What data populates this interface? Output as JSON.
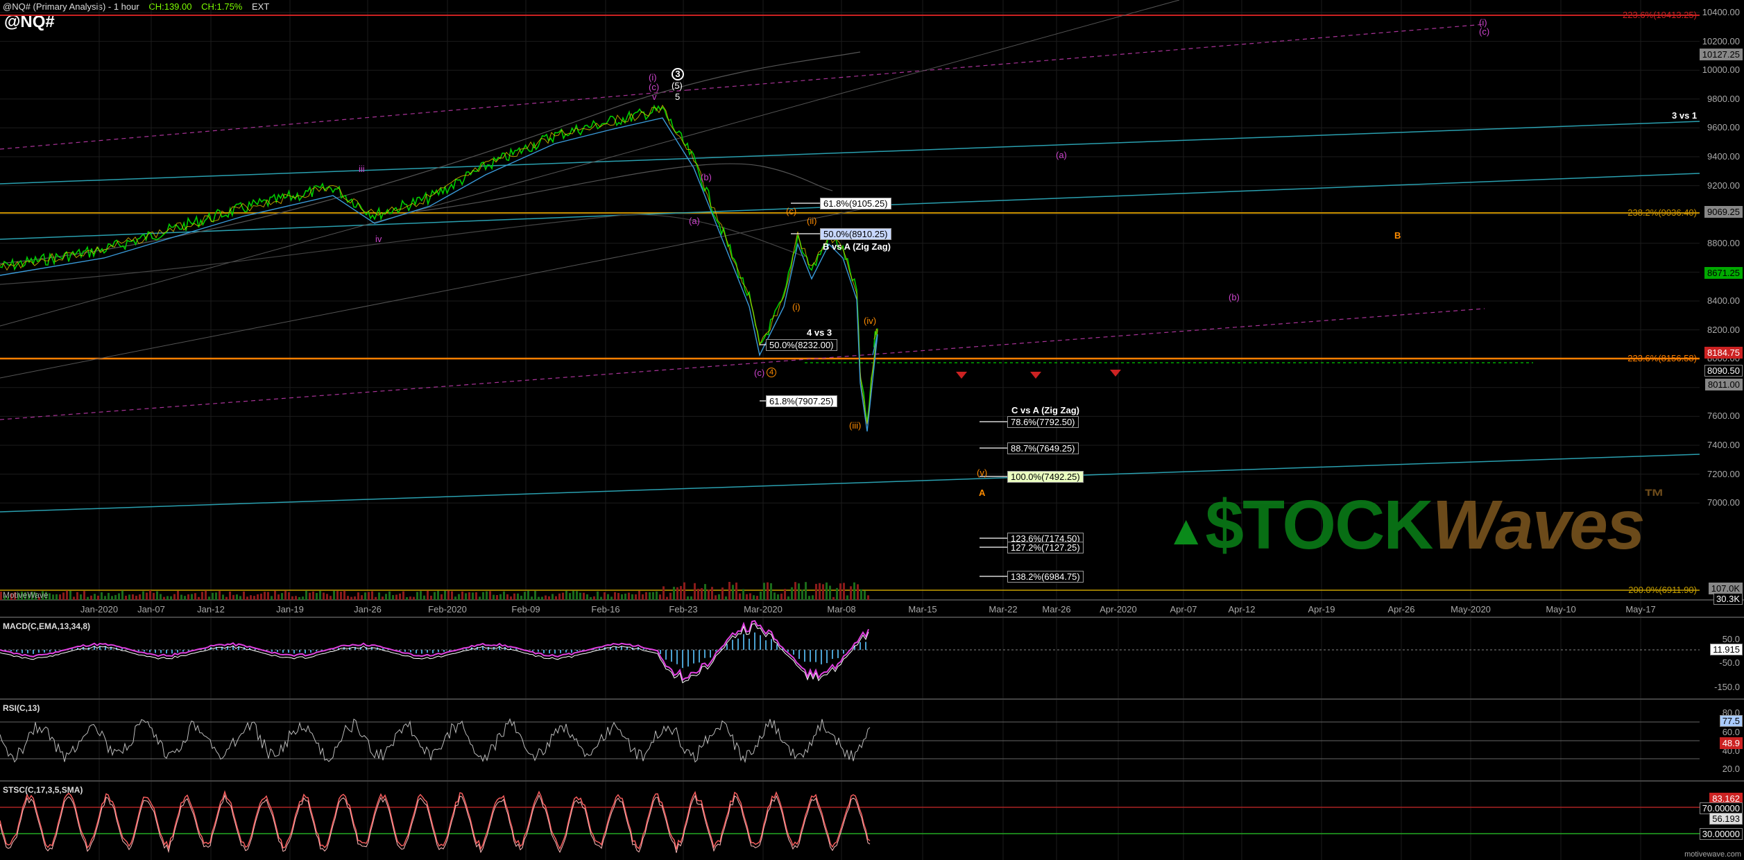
{
  "header": {
    "title": "@NQ# (Primary Analysis) - 1 hour",
    "change_points": "CH:139.00",
    "change_pct": "CH:1.75%",
    "session": "EXT",
    "symbol": "@NQ#"
  },
  "price_pane": {
    "study_label": "MotiveWave",
    "y_ticks": [
      "10400.00",
      "10200.00",
      "10000.00",
      "9800.00",
      "9600.00",
      "9400.00",
      "9200.00",
      "9000.00",
      "8800.00",
      "8600.00",
      "8400.00",
      "8200.00",
      "8000.00",
      "7800.00",
      "7600.00",
      "7400.00",
      "7200.00",
      "7000.00"
    ],
    "x_ticks": [
      "Jan-2020",
      "Jan-07",
      "Jan-12",
      "Jan-19",
      "Jan-26",
      "Feb-2020",
      "Feb-09",
      "Feb-16",
      "Feb-23",
      "Mar-2020",
      "Mar-08",
      "Mar-15",
      "Mar-22",
      "Mar-26",
      "Apr-2020",
      "Apr-07",
      "Apr-12",
      "Apr-19",
      "Apr-26",
      "May-2020",
      "May-10",
      "May-17"
    ],
    "price_tags": [
      {
        "text": "10127.25",
        "color": "#888888"
      },
      {
        "text": "9069.25",
        "color": "#888888"
      },
      {
        "text": "8671.25",
        "color": "#00aa00"
      },
      {
        "text": "8184.75",
        "color": "#cc2222"
      },
      {
        "text": "8090.50",
        "color": "#888888"
      },
      {
        "text": "8011.00",
        "color": "#888888"
      },
      {
        "text": "107.0K",
        "color": "#888888"
      },
      {
        "text": "30.3K",
        "color": "#888888"
      }
    ],
    "level_labels": [
      {
        "text": "223.6%(10413.25)",
        "color": "#cc2222"
      },
      {
        "text": "238.2%(9036.40)",
        "color": "#c89000"
      },
      {
        "text": "223.6%(8156.58)",
        "color": "#ff7f00"
      },
      {
        "text": "200.0%(6911.90)",
        "color": "#c8a000"
      }
    ],
    "fib_boxes": [
      {
        "text": "61.8%(9105.25)"
      },
      {
        "text": "50.0%(8910.25)"
      },
      {
        "text": "50.0%(8232.00)"
      },
      {
        "text": "61.8%(7907.25)"
      },
      {
        "text": "78.6%(7792.50)"
      },
      {
        "text": "88.7%(7649.25)"
      },
      {
        "text": "100.0%(7492.25)"
      },
      {
        "text": "123.6%(7174.50)"
      },
      {
        "text": "127.2%(7127.25)"
      },
      {
        "text": "138.2%(6984.75)"
      }
    ],
    "notes": [
      "3 vs 1",
      "B vs A (Zig Zag)",
      "4 vs 3",
      "C vs A (Zig Zag)"
    ],
    "wave_labels": [
      "3",
      "(5)",
      "5",
      "(i)",
      "(c)",
      "v",
      "iii",
      "iv",
      "(b)",
      "(a)",
      "(c)",
      "(ii)",
      "(i)",
      "(iv)",
      "(iii)",
      "(c)",
      "(a)",
      "(b)",
      "(v)",
      "A",
      "B",
      "(i)",
      "(c)",
      "4"
    ]
  },
  "logo": {
    "prefix": "$TOCK",
    "suffix": "Waves",
    "tm": "™"
  },
  "macd": {
    "title": "MACD(C,EMA,13,34,8)",
    "ticks": [
      "50.0",
      "-50.0",
      "-150.0"
    ],
    "value": "11.915"
  },
  "rsi": {
    "title": "RSI(C,13)",
    "ticks": [
      "80.0",
      "60.0",
      "40.0",
      "20.0"
    ],
    "value1": "77.5",
    "value2": "48.9"
  },
  "stsc": {
    "title": "STSC(C,17,3,5,SMA)",
    "values": [
      "83.162",
      "70.00000",
      "56.193",
      "30.00000"
    ]
  },
  "footer": "motivewave.com",
  "colors": {
    "bg": "#000000",
    "grid": "#1a1a1a",
    "up": "#00cc00",
    "down": "#cc2222",
    "fib_orange": "#ff7f00",
    "wave_magenta": "#cc44cc",
    "channel_cyan": "#2aa0b0"
  }
}
